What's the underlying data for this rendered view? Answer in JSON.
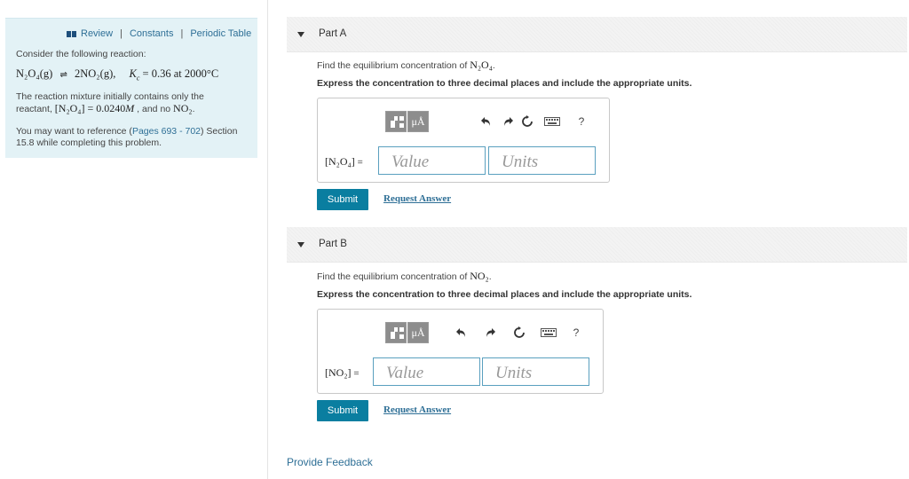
{
  "sidebar": {
    "links": [
      "Review",
      "Constants",
      "Periodic Table"
    ],
    "intro": "Consider the following reaction:",
    "reaction": {
      "reactant": "N₂O₄(g)",
      "arrows": "⇌",
      "product": "2NO₂(g),",
      "kc_label": "K",
      "kc_sub": "c",
      "kc_value": "= 0.36 at 2000°C"
    },
    "mixture_line1": "The reaction mixture initially contains only the",
    "mixture_pre": "reactant,",
    "mixture_math": "[N₂O₄] = 0.0240",
    "mixture_unit": "M",
    "mixture_mid": ", and no",
    "mixture_no2": "NO₂",
    "mixture_end": ".",
    "ref_pre": "You may want to reference (",
    "ref_link": "Pages 693 - 702",
    "ref_post": ") Section",
    "ref_line2": "15.8 while completing this problem."
  },
  "parts": [
    {
      "title": "Part A",
      "question_text": "Find the equilibrium concentration of",
      "question_math": "N₂O₄",
      "question_end": ".",
      "instruction": "Express the concentration to three decimal places and include the appropriate units.",
      "answer_label": "[N₂O₄]",
      "eq_sign": " =",
      "value_placeholder": "Value",
      "units_placeholder": "Units",
      "mu_label": "μÅ",
      "help_label": "?",
      "submit_label": "Submit",
      "request_label": "Request Answer"
    },
    {
      "title": "Part B",
      "question_text": "Find the equilibrium concentration of",
      "question_math": "NO₂",
      "question_end": ".",
      "instruction": "Express the concentration to three decimal places and include the appropriate units.",
      "answer_label": "[NO₂]",
      "eq_sign": " =",
      "value_placeholder": "Value",
      "units_placeholder": "Units",
      "mu_label": "μÅ",
      "help_label": "?",
      "submit_label": "Submit",
      "request_label": "Request Answer"
    }
  ],
  "feedback_label": "Provide Feedback",
  "colors": {
    "accent": "#0a7ea0",
    "link": "#2e6f96",
    "sidebar_bg": "#e3f2f6",
    "field_border": "#5aa0bf"
  }
}
